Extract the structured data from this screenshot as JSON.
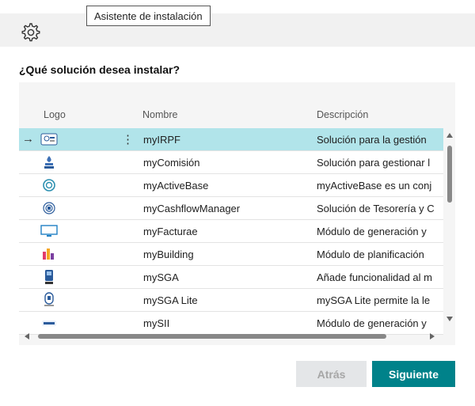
{
  "tooltip": "Asistente de instalación",
  "question": "¿Qué solución desea instalar?",
  "columns": {
    "logo": "Logo",
    "name": "Nombre",
    "description": "Descripción"
  },
  "rows": [
    {
      "logo": "myIRPF",
      "name": "myIRPF",
      "description": "Solución para la gestión",
      "selected": true
    },
    {
      "logo": "myComisión",
      "name": "myComisión",
      "description": "Solución para gestionar l"
    },
    {
      "logo": "myActiveBase",
      "name": "myActiveBase",
      "description": "myActiveBase es un conj"
    },
    {
      "logo": "myCashflow",
      "name": "myCashflowManager",
      "description": "Solución de Tesorería y C"
    },
    {
      "logo": "myFacturae",
      "name": "myFacturae",
      "description": "Módulo de generación y"
    },
    {
      "logo": "myBuilding",
      "name": "myBuilding",
      "description": "Módulo de planificación"
    },
    {
      "logo": "mySGA",
      "name": "mySGA",
      "description": "Añade funcionalidad al m"
    },
    {
      "logo": "mySGALite",
      "name": "mySGA Lite",
      "description": "mySGA Lite permite la le"
    },
    {
      "logo": "mySII",
      "name": "mySII",
      "description": "Módulo de generación y"
    }
  ],
  "buttons": {
    "back": "Atrás",
    "next": "Siguiente"
  },
  "colors": {
    "selected_row": "#b1e4ea",
    "primary": "#00828a",
    "disabled": "#e4e6e8"
  },
  "icons": {
    "settings": "gear-icon",
    "row_arrow": "arrow-right-icon",
    "row_menu": "vertical-dots-icon"
  }
}
